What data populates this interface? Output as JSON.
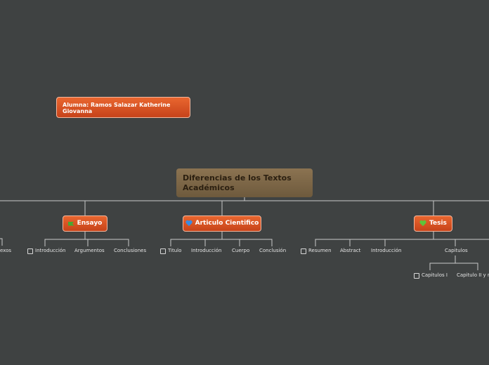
{
  "central": {
    "title": "Diferencias de los Textos Académicos"
  },
  "note": {
    "text": "Alumna: Ramos Salazar Katherine Giovanna"
  },
  "branches": {
    "left_partial": {
      "subs": [
        "exos"
      ]
    },
    "ensayo": {
      "label": "Ensayo",
      "icon": "green-flag-icon",
      "subs": [
        "Introducción",
        "Argumentos",
        "Conclusiones"
      ]
    },
    "articulo": {
      "label": "Articulo Cientifico",
      "icon": "blue-heart-icon",
      "subs": [
        "Titulo",
        "Introducción",
        "Cuerpo",
        "Conclusión"
      ]
    },
    "tesis": {
      "label": "Tesis",
      "icon": "green-heart-icon",
      "subs": [
        "Resumen",
        "Abstract",
        "Introducción",
        "Capitulos"
      ],
      "capitulos_subs": [
        "Capitulos I",
        "Capitulo II y r"
      ]
    }
  },
  "colors": {
    "background": "#3f4242",
    "topic": "#d9531f",
    "central": "#7d6747",
    "lines": "#c9c9c9"
  }
}
